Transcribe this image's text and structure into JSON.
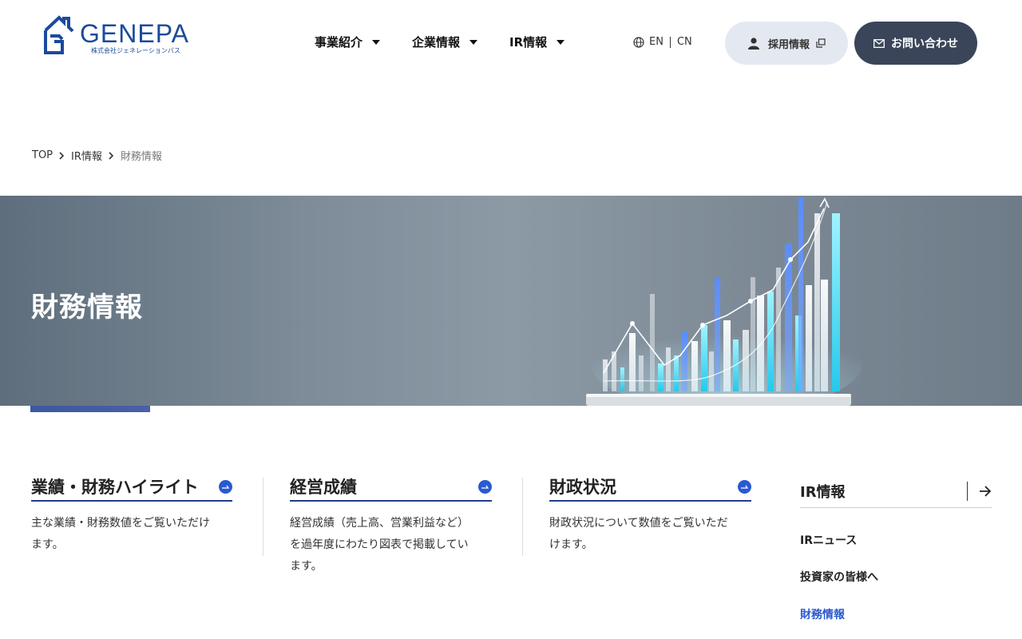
{
  "header": {
    "logo_text": "GENEPA",
    "logo_sub": "株式会社ジェネレーションパス",
    "nav": [
      {
        "label": "事業紹介"
      },
      {
        "label": "企業情報"
      },
      {
        "label": "IR情報"
      }
    ],
    "lang_en": "EN",
    "lang_cn": "CN",
    "recruit_label": "採用情報",
    "contact_label": "お問い合わせ"
  },
  "breadcrumb": {
    "top": "TOP",
    "ir": "IR情報",
    "current": "財務情報"
  },
  "hero": {
    "title": "財務情報"
  },
  "cards": [
    {
      "title": "業績・財務ハイライト",
      "desc_line1": "主な業績・財務数値をご覧いただけ",
      "desc_line2": "ます。"
    },
    {
      "title": "経営成績",
      "desc_line1": "経営成績（売上高、営業利益など）",
      "desc_line2": "を過年度にわたり図表で掲載してい",
      "desc_line3": "ます。"
    },
    {
      "title": "財政状況",
      "desc_line1": "財政状況について数値をご覧いただ",
      "desc_line2": "けます。"
    }
  ],
  "sidebar": {
    "title": "IR情報",
    "links": [
      {
        "label": "IRニュース"
      },
      {
        "label": "投資家の皆様へ"
      },
      {
        "label": "財務情報"
      }
    ]
  },
  "colors": {
    "brand": "#1c4a9c",
    "accent": "#2a5ad0",
    "contact_bg": "#3a4559",
    "recruit_bg": "#e4e9f1"
  },
  "icons": [
    "globe-icon",
    "person-icon",
    "external-link-icon",
    "mail-icon",
    "chevron-right-icon",
    "arrow-circle-icon",
    "arrow-right-icon"
  ]
}
